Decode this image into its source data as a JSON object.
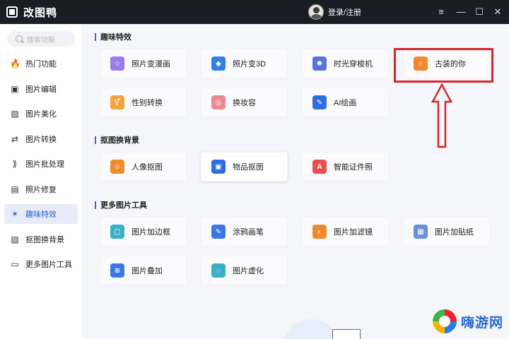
{
  "titlebar": {
    "app_title": "改图鸭",
    "login_label": "登录/注册",
    "controls": {
      "menu": "≡",
      "minimize": "—",
      "maximize": "☐",
      "close": "✕"
    }
  },
  "sidebar": {
    "search_placeholder": "搜索功能",
    "active_index": 6,
    "items": [
      {
        "label": "热门功能",
        "icon": "flame-icon"
      },
      {
        "label": "图片编辑",
        "icon": "image-edit-icon"
      },
      {
        "label": "图片美化",
        "icon": "image-beautify-icon"
      },
      {
        "label": "图片转换",
        "icon": "image-convert-icon"
      },
      {
        "label": "图片批处理",
        "icon": "batch-icon"
      },
      {
        "label": "照片修复",
        "icon": "photo-repair-icon"
      },
      {
        "label": "趣味特效",
        "icon": "magic-wand-icon"
      },
      {
        "label": "抠图换背景",
        "icon": "cutout-icon"
      },
      {
        "label": "更多图片工具",
        "icon": "toolbox-icon"
      }
    ]
  },
  "sections": [
    {
      "title": "趣味特效",
      "tools": [
        {
          "label": "照片变漫画",
          "icon": "cartoon-icon",
          "color": "#9b7be8"
        },
        {
          "label": "照片变3D",
          "icon": "cube-3d-icon",
          "color": "#2f7fe6"
        },
        {
          "label": "时光穿梭机",
          "icon": "ufo-icon",
          "color": "#5a72d8"
        },
        {
          "label": "古装的你",
          "icon": "ancient-house-icon",
          "color": "#f08a2c"
        },
        {
          "label": "性别转换",
          "icon": "gender-icon",
          "color": "#f3a43a"
        },
        {
          "label": "换妆容",
          "icon": "makeup-icon",
          "color": "#e98a93"
        },
        {
          "label": "AI绘画",
          "icon": "palette-icon",
          "color": "#2f6ee0"
        }
      ]
    },
    {
      "title": "抠图换背景",
      "tools": [
        {
          "label": "人像抠图",
          "icon": "portrait-cutout-icon",
          "color": "#f08a2c"
        },
        {
          "label": "物品抠图",
          "icon": "object-cutout-icon",
          "color": "#2f6ee0"
        },
        {
          "label": "智能证件照",
          "icon": "id-photo-icon",
          "color": "#e8504f"
        }
      ]
    },
    {
      "title": "更多图片工具",
      "tools": [
        {
          "label": "图片加边框",
          "icon": "frame-icon",
          "color": "#3ab0c6"
        },
        {
          "label": "涂鸦画笔",
          "icon": "brush-icon",
          "color": "#3a78e6"
        },
        {
          "label": "图片加滤镜",
          "icon": "filter-icon",
          "color": "#f08a2c"
        },
        {
          "label": "图片加贴纸",
          "icon": "sticker-icon",
          "color": "#6d8fd6"
        },
        {
          "label": "图片叠加",
          "icon": "layers-icon",
          "color": "#3a78e6"
        },
        {
          "label": "图片虚化",
          "icon": "blur-icon",
          "color": "#3ab0c6"
        }
      ]
    }
  ],
  "watermark": {
    "text": "嗨游网"
  },
  "annotation_color": "#d7262d"
}
